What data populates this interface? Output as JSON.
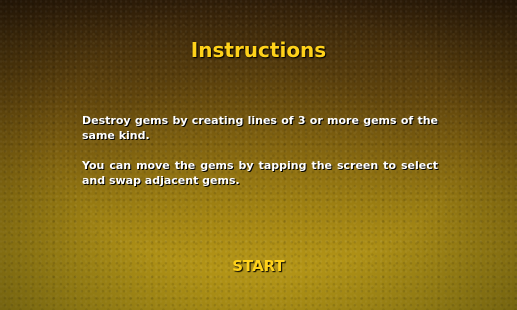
{
  "screen": {
    "title": "Instructions",
    "paragraphs": [
      "Destroy gems by creating lines of 3 or more gems of the same kind.",
      "You can move the gems by tapping the screen to select and swap adjacent gems."
    ],
    "start_label": "START"
  },
  "colors": {
    "title": "#ffd21a",
    "body_text": "#ffffff",
    "background_top": "#2f1d08",
    "background_bottom": "#b39918"
  }
}
